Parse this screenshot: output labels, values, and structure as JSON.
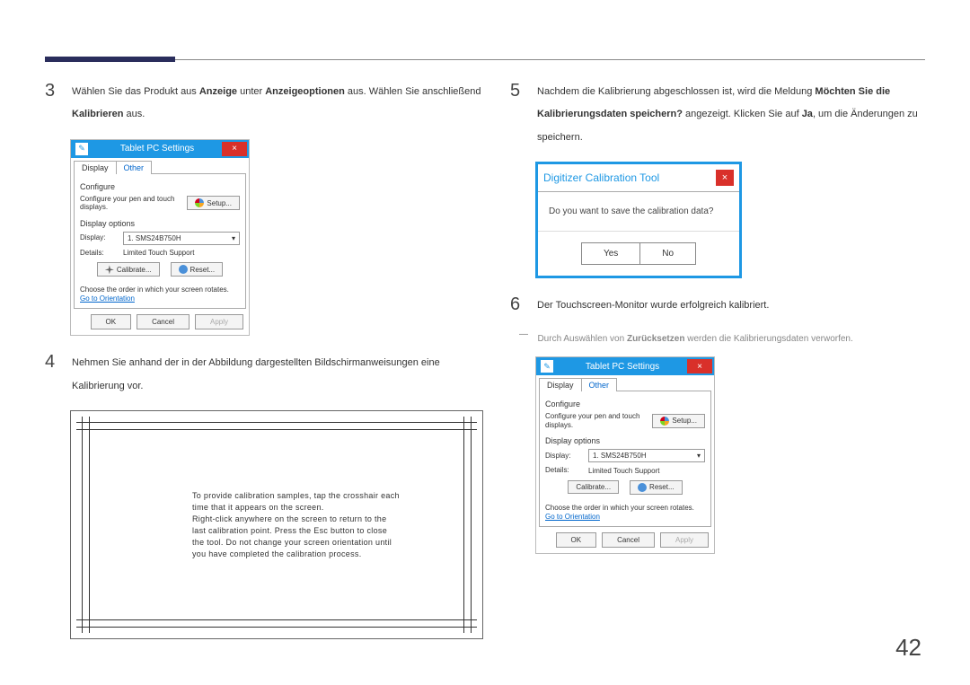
{
  "page_number": "42",
  "left": {
    "step3": {
      "num": "3",
      "text_pre": "Wählen Sie das Produkt aus ",
      "b1": "Anzeige",
      "mid": " unter ",
      "b2": "Anzeigeoptionen",
      "after": " aus. Wählen Sie anschließend ",
      "b3": "Kalibrieren",
      "end": " aus."
    },
    "shot_a": {
      "title": "Tablet PC Settings",
      "tabs": {
        "display": "Display",
        "other": "Other"
      },
      "configure": "Configure",
      "cfg_label": "Configure your pen and touch displays.",
      "setup": "Setup...",
      "disp_opts": "Display options",
      "display_lbl": "Display:",
      "display_val": "1. SMS24B750H",
      "details_lbl": "Details:",
      "details_val": "Limited Touch Support",
      "calibrate": "Calibrate...",
      "reset": "Reset...",
      "order_text": "Choose the order in which your screen rotates.",
      "go_link": "Go to Orientation",
      "ok": "OK",
      "cancel": "Cancel",
      "apply": "Apply"
    },
    "step4": {
      "num": "4",
      "text": "Nehmen Sie anhand der in der Abbildung dargestellten Bildschirmanweisungen eine Kalibrierung vor."
    },
    "cal_text": {
      "l1": "To provide calibration samples, tap the crosshair each",
      "l2": "time that it appears on the screen.",
      "l3": "Right-click anywhere on the screen to return to the",
      "l4": "last calibration point. Press the Esc button to close",
      "l5": "the tool. Do not change your screen orientation until",
      "l6": "you have completed the calibration process."
    }
  },
  "right": {
    "step5": {
      "num": "5",
      "pre": "Nachdem die Kalibrierung abgeschlossen ist, wird die Meldung ",
      "b1": "Möchten Sie die Kalibrierungsdaten speichern?",
      "mid": " angezeigt. Klicken Sie auf ",
      "b2": "Ja",
      "end": ", um die Änderungen zu speichern."
    },
    "dialog": {
      "title": "Digitizer Calibration Tool",
      "body": "Do you want to save the calibration data?",
      "yes": "Yes",
      "no": "No"
    },
    "step6": {
      "num": "6",
      "text": "Der Touchscreen-Monitor wurde erfolgreich kalibriert."
    },
    "note": {
      "pre": "Durch Auswählen von ",
      "b": "Zurücksetzen",
      "post": " werden die Kalibrierungsdaten verworfen."
    },
    "shot_b": {
      "title": "Tablet PC Settings",
      "tabs": {
        "display": "Display",
        "other": "Other"
      },
      "configure": "Configure",
      "cfg_label": "Configure your pen and touch displays.",
      "setup": "Setup...",
      "disp_opts": "Display options",
      "display_lbl": "Display:",
      "display_val": "1. SMS24B750H",
      "details_lbl": "Details:",
      "details_val": "Limited Touch Support",
      "calibrate": "Calibrate...",
      "reset": "Reset...",
      "order_text": "Choose the order in which your screen rotates.",
      "go_link": "Go to Orientation",
      "ok": "OK",
      "cancel": "Cancel",
      "apply": "Apply"
    }
  }
}
